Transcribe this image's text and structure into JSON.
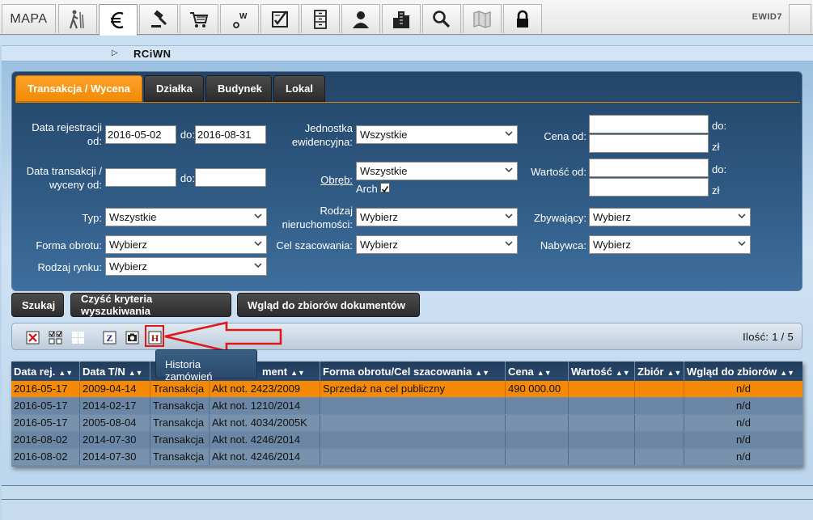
{
  "toolbar": {
    "mapa_label": "MAPA",
    "user": "EWID7",
    "icons": [
      "hiker-icon",
      "euro-icon",
      "gavel-icon",
      "cart-icon",
      "scale-w-icon",
      "checklist-icon",
      "cabinet-icon",
      "person-icon",
      "building-icon",
      "search-icon",
      "map-icon",
      "lock-icon"
    ]
  },
  "breadcrumb": {
    "title": "RCiWN"
  },
  "tabs": [
    "Transakcja / Wycena",
    "Działka",
    "Budynek",
    "Lokal"
  ],
  "form": {
    "data_rejestracji_label": "Data rejestracji od:",
    "data_rej_from": "2016-05-02",
    "do_label": "do:",
    "data_rej_to": "2016-08-31",
    "data_transakcji_label": "Data transakcji / wyceny od:",
    "data_trans_from": "",
    "data_trans_to": "",
    "typ_label": "Typ:",
    "typ_value": "Wszystkie",
    "forma_obrotu_label": "Forma obrotu:",
    "forma_obrotu_value": "Wybierz",
    "rodzaj_rynku_label": "Rodzaj rynku:",
    "rodzaj_rynku_value": "Wybierz",
    "jednostka_label": "Jednostka ewidencyjna:",
    "jednostka_value": "Wszystkie",
    "obreb_label": "Obręb:",
    "obreb_value": "Wszystkie",
    "arch_label": "Arch",
    "arch_checked": true,
    "rodzaj_nier_label": "Rodzaj nieruchomości:",
    "rodzaj_nier_value": "Wybierz",
    "cel_label": "Cel szacowania:",
    "cel_value": "Wybierz",
    "cena_label": "Cena od:",
    "cena_do_label": "do:",
    "cena_zl": "zł",
    "wartosc_label": "Wartość od:",
    "wartosc_do_label": "do:",
    "wartosc_zl": "zł",
    "zbywajacy_label": "Zbywający:",
    "zbywajacy_value": "Wybierz",
    "nabywca_label": "Nabywca:",
    "nabywca_value": "Wybierz"
  },
  "actions": {
    "szukaj": "Szukaj",
    "czysc": "Czyść kryteria wyszukiwania",
    "wglad": "Wgląd do zbiorów dokumentów"
  },
  "results": {
    "count": "Ilość: 1 / 5",
    "tooltip": "Historia zamówień",
    "columns": [
      "Data rej.",
      "Data T/N",
      "",
      "ment",
      "Forma obrotu/Cel szacowania",
      "Cena",
      "Wartość",
      "Zbiór",
      "Wgląd do zbiorów"
    ],
    "rows": [
      [
        "2016-05-17",
        "2009-04-14",
        "Transakcja",
        "Akt not. 2423/2009",
        "Sprzedaż na cel publiczny",
        "490 000.00",
        "",
        "",
        "n/d"
      ],
      [
        "2016-05-17",
        "2014-02-17",
        "Transakcja",
        "Akt not. 1210/2014",
        "",
        "",
        "",
        "",
        "n/d"
      ],
      [
        "2016-05-17",
        "2005-08-04",
        "Transakcja",
        "Akt not. 4034/2005K",
        "",
        "",
        "",
        "",
        "n/d"
      ],
      [
        "2016-08-02",
        "2014-07-30",
        "Transakcja",
        "Akt not. 4246/2014",
        "",
        "",
        "",
        "",
        "n/d"
      ],
      [
        "2016-08-02",
        "2014-07-30",
        "Transakcja",
        "Akt not. 4246/2014",
        "",
        "",
        "",
        "",
        "n/d"
      ]
    ]
  },
  "colors": {
    "accent": "#f48a07",
    "panel": "#2f5a84",
    "header": "#213c5c",
    "highlight": "#e01818"
  }
}
